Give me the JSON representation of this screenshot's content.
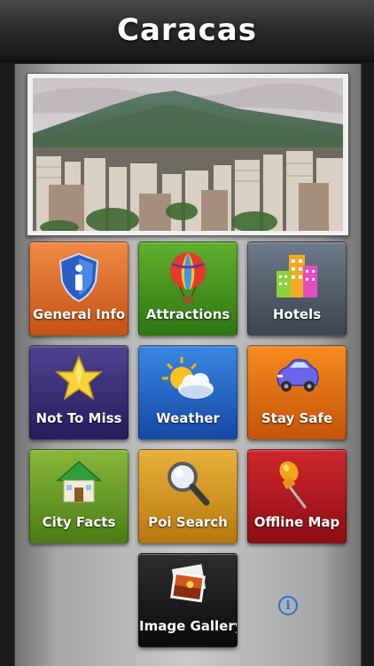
{
  "header": {
    "title": "Caracas"
  },
  "tiles": [
    {
      "label": "General Info",
      "icon": "shield-info-icon"
    },
    {
      "label": "Attractions",
      "icon": "hot-air-balloon-icon"
    },
    {
      "label": "Hotels",
      "icon": "buildings-icon"
    },
    {
      "label": "Not To Miss",
      "icon": "star-icon"
    },
    {
      "label": "Weather",
      "icon": "sun-cloud-icon"
    },
    {
      "label": "Stay Safe",
      "icon": "car-icon"
    },
    {
      "label": "City Facts",
      "icon": "house-icon"
    },
    {
      "label": "Poi Search",
      "icon": "magnifier-icon"
    },
    {
      "label": "Offline Map",
      "icon": "map-pin-icon"
    },
    {
      "label": "Image Gallery",
      "icon": "photos-icon"
    }
  ],
  "info_button": {
    "glyph": "i"
  },
  "colors": {
    "general_info": "#e0702e",
    "attractions": "#4a9822",
    "hotels": "#56616e",
    "not_to_miss": "#3a2f78",
    "weather": "#2566c8",
    "stay_safe": "#e06e14",
    "city_facts": "#6c9c28",
    "poi_search": "#d49a22",
    "offline_map": "#b41a22",
    "image_gallery": "#1e1e1e",
    "info": "#2a6fd8"
  }
}
